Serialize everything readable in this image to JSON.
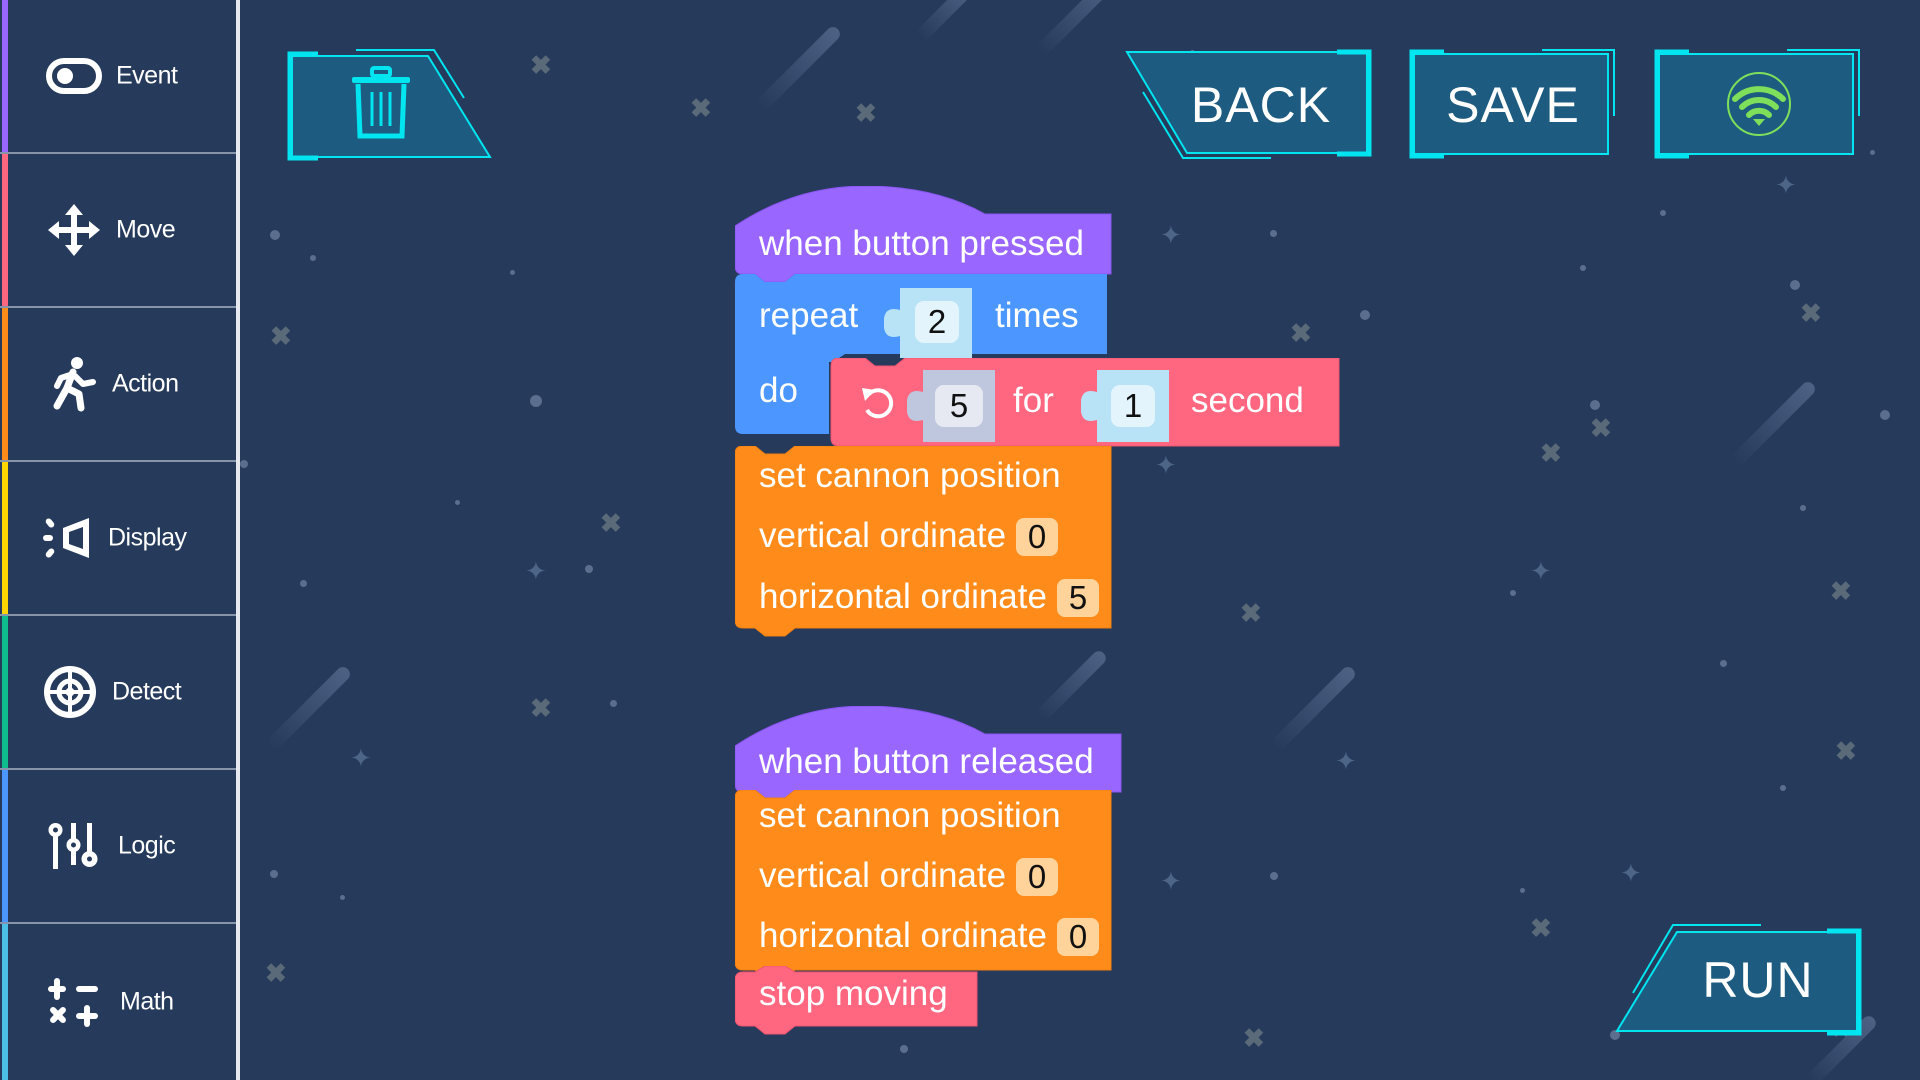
{
  "sidebar": {
    "items": [
      {
        "label": "Event",
        "icon": "toggle-icon",
        "color": "#9966ff"
      },
      {
        "label": "Move",
        "icon": "move-arrows-icon",
        "color": "#ff6680"
      },
      {
        "label": "Action",
        "icon": "running-person-icon",
        "color": "#ff8c1a"
      },
      {
        "label": "Display",
        "icon": "speaker-icon",
        "color": "#ffd500"
      },
      {
        "label": "Detect",
        "icon": "target-icon",
        "color": "#0fbd8c"
      },
      {
        "label": "Logic",
        "icon": "sliders-icon",
        "color": "#4c97ff"
      },
      {
        "label": "Math",
        "icon": "math-operators-icon",
        "color": "#4cbfe6"
      }
    ]
  },
  "toolbar": {
    "back_label": "BACK",
    "save_label": "SAVE",
    "run_label": "RUN",
    "trash_icon": "trash-icon",
    "connection_icon": "wifi-icon",
    "accent": "#00e5f0",
    "connection_color": "#7ee05a"
  },
  "scripts": [
    {
      "hat": "when button pressed",
      "repeat": {
        "label": "repeat",
        "count": "2",
        "suffix": "times",
        "do_label": "do"
      },
      "rotate": {
        "icon": "rotate-icon",
        "speed": "5",
        "for_label": "for",
        "duration": "1",
        "unit": "second"
      },
      "set_position": {
        "label": "set cannon position",
        "vertical_label": "vertical ordinate",
        "vertical": "0",
        "horizontal_label": "horizontal ordinate",
        "horizontal": "5"
      }
    },
    {
      "hat": "when button released",
      "set_position": {
        "label": "set cannon position",
        "vertical_label": "vertical ordinate",
        "vertical": "0",
        "horizontal_label": "horizontal ordinate",
        "horizontal": "0"
      },
      "stop": "stop moving"
    }
  ],
  "colors": {
    "event": "#9966ff",
    "control": "#4c97ff",
    "move": "#ff6680",
    "action": "#ff8c1a"
  }
}
